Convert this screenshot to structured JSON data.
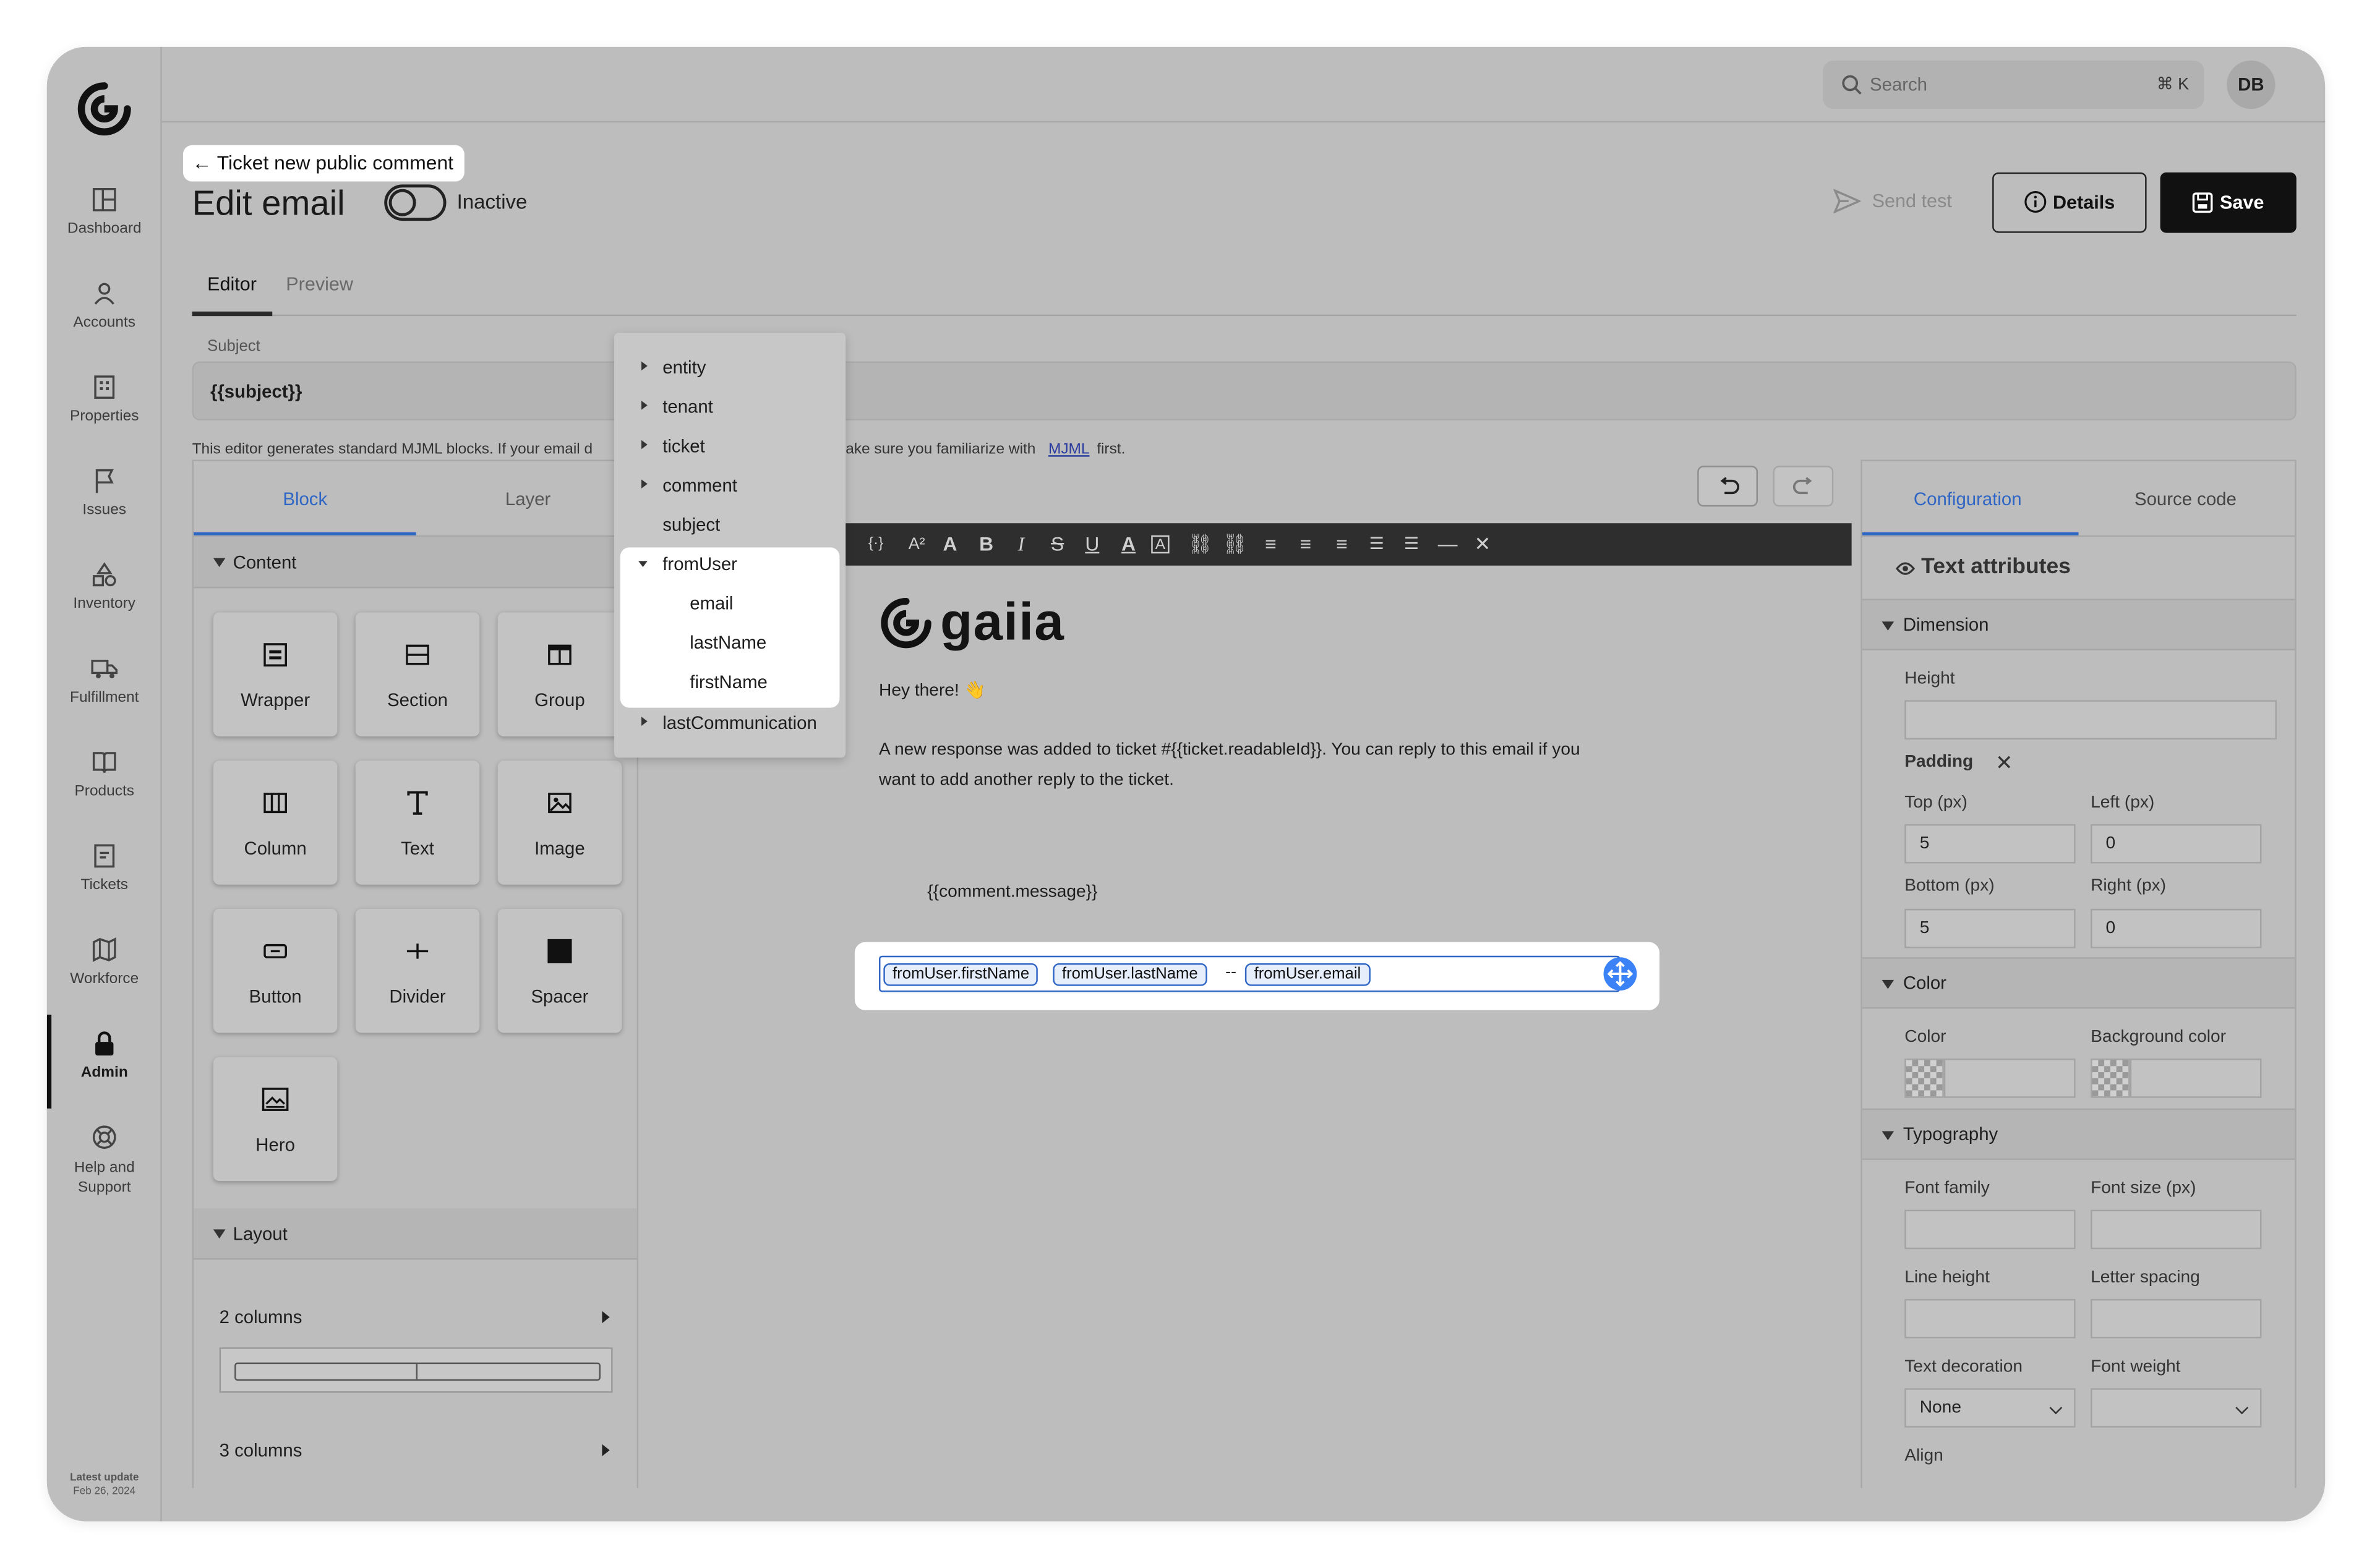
{
  "nav": {
    "items": [
      {
        "label": "Dashboard",
        "icon": "dashboard-icon"
      },
      {
        "label": "Accounts",
        "icon": "user-icon"
      },
      {
        "label": "Properties",
        "icon": "building-icon"
      },
      {
        "label": "Issues",
        "icon": "flag-icon"
      },
      {
        "label": "Inventory",
        "icon": "shapes-icon"
      },
      {
        "label": "Fulfillment",
        "icon": "truck-icon"
      },
      {
        "label": "Products",
        "icon": "book-icon"
      },
      {
        "label": "Tickets",
        "icon": "ticket-icon"
      },
      {
        "label": "Workforce",
        "icon": "map-icon"
      },
      {
        "label": "Admin",
        "icon": "lock-icon"
      },
      {
        "label": "Help and Support",
        "icon": "lifebuoy-icon"
      }
    ],
    "active": "Admin",
    "latest_update_label": "Latest update",
    "latest_update_date": "Feb 26, 2024"
  },
  "topbar": {
    "search_placeholder": "Search",
    "search_shortcut": "⌘ K",
    "avatar_initials": "DB"
  },
  "header": {
    "back_label": "Ticket new public comment",
    "title": "Edit email",
    "status_label": "Inactive",
    "send_test_label": "Send test",
    "details_label": "Details",
    "save_label": "Save"
  },
  "tabs": {
    "editor": "Editor",
    "preview": "Preview"
  },
  "subject": {
    "label": "Subject",
    "value": "{{subject}}"
  },
  "notice": {
    "start": "This editor generates standard MJML blocks. If your email d",
    "end": "ake sure you familiarize with",
    "link": "MJML",
    "tail": "first."
  },
  "left_panel": {
    "tab_block": "Block",
    "tab_layer": "Layer",
    "content_heading": "Content",
    "blocks": [
      "Wrapper",
      "Section",
      "Group",
      "Column",
      "Text",
      "Image",
      "Button",
      "Divider",
      "Spacer",
      "Hero"
    ],
    "layout_heading": "Layout",
    "layouts": [
      "2 columns",
      "3 columns"
    ]
  },
  "dropdown": {
    "items": [
      "entity",
      "tenant",
      "ticket",
      "comment",
      "subject",
      "fromUser"
    ],
    "sub_items": [
      "email",
      "lastName",
      "firstName"
    ],
    "last_item": "lastCommunication"
  },
  "email": {
    "brand": "gaiia",
    "greeting": "Hey there! 👋",
    "body_line1": "A new response was added to ticket #{{ticket.readableId}}. You can reply to this email if you",
    "body_line2": "want to add another reply to the ticket.",
    "comment_var": "{{comment.message}}",
    "chips": [
      "fromUser.firstName",
      "fromUser.lastName",
      "fromUser.email"
    ],
    "separator": "--"
  },
  "right_panel": {
    "tab_config": "Configuration",
    "tab_source": "Source code",
    "title": "Text attributes",
    "dimension_heading": "Dimension",
    "height_label": "Height",
    "padding_label": "Padding",
    "top_label": "Top (px)",
    "top_value": "5",
    "left_label": "Left (px)",
    "left_value": "0",
    "bottom_label": "Bottom (px)",
    "bottom_value": "5",
    "right_label": "Right (px)",
    "right_value": "0",
    "color_heading": "Color",
    "color_label": "Color",
    "bg_color_label": "Background color",
    "typography_heading": "Typography",
    "font_family_label": "Font family",
    "font_size_label": "Font size (px)",
    "line_height_label": "Line height",
    "letter_spacing_label": "Letter spacing",
    "text_decoration_label": "Text decoration",
    "text_decoration_value": "None",
    "font_weight_label": "Font weight",
    "align_label": "Align"
  }
}
